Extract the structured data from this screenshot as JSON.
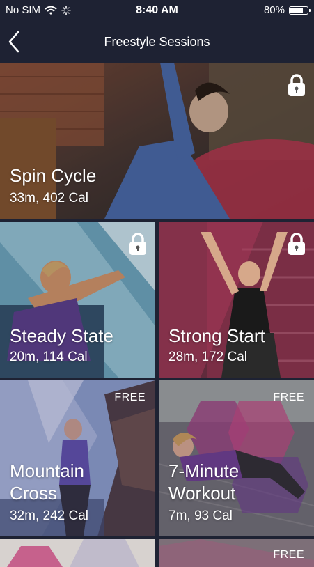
{
  "status_bar": {
    "carrier": "No SIM",
    "time": "8:40 AM",
    "battery": "80%",
    "battery_level": 0.8,
    "icons": [
      "wifi-icon",
      "activity-spinner-icon",
      "battery-icon"
    ]
  },
  "nav": {
    "title": "Freestyle Sessions",
    "back_icon": "chevron-left-icon"
  },
  "colors": {
    "nav_background": "#1e2233",
    "card_divider": "#ffffff"
  },
  "sessions": [
    {
      "title": "Spin Cycle",
      "meta": "33m, 402 Cal",
      "badge": "lock-icon"
    },
    {
      "title": "Steady State",
      "meta": "20m, 114 Cal",
      "badge": "lock-icon"
    },
    {
      "title": "Strong Start",
      "meta": "28m, 172 Cal",
      "badge": "lock-icon"
    },
    {
      "title": "Mountain\nCross",
      "meta": "32m, 242 Cal",
      "badge": "FREE"
    },
    {
      "title": "7-Minute\nWorkout",
      "meta": "7m, 93 Cal",
      "badge": "FREE"
    },
    {
      "title": "",
      "meta": "",
      "badge": ""
    },
    {
      "title": "",
      "meta": "",
      "badge": "FREE"
    }
  ]
}
